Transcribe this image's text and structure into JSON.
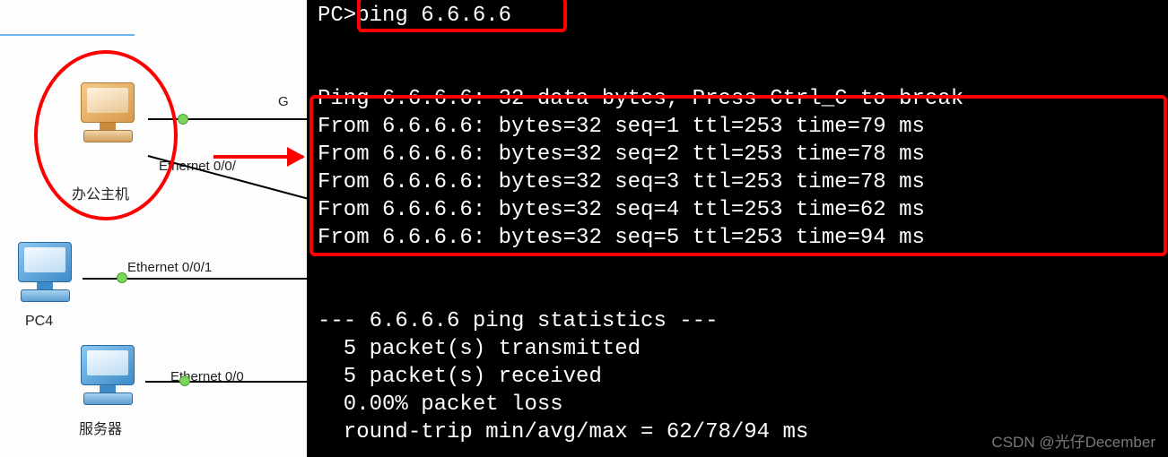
{
  "topology": {
    "pc1": {
      "label": "办公主机",
      "port": "Ethernet 0/0/"
    },
    "pc4": {
      "label": "PC4",
      "port": "Ethernet 0/0/1"
    },
    "server": {
      "label": "服务器",
      "port": "Ethernet 0/0"
    },
    "right_port_partial": "G"
  },
  "terminal": {
    "prompt": "PC>",
    "command": "ping 6.6.6.6",
    "header": "Ping 6.6.6.6: 32 data bytes, Press Ctrl_C to break",
    "replies": [
      "From 6.6.6.6: bytes=32 seq=1 ttl=253 time=79 ms",
      "From 6.6.6.6: bytes=32 seq=2 ttl=253 time=78 ms",
      "From 6.6.6.6: bytes=32 seq=3 ttl=253 time=78 ms",
      "From 6.6.6.6: bytes=32 seq=4 ttl=253 time=62 ms",
      "From 6.6.6.6: bytes=32 seq=5 ttl=253 time=94 ms"
    ],
    "stats_header": "--- 6.6.6.6 ping statistics ---",
    "stats": [
      "  5 packet(s) transmitted",
      "  5 packet(s) received",
      "  0.00% packet loss",
      "  round-trip min/avg/max = 62/78/94 ms"
    ]
  },
  "watermark": "CSDN @光仔December"
}
